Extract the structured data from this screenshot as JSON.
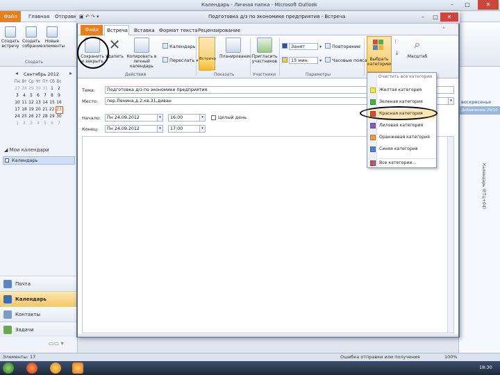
{
  "outlook": {
    "title": "Календарь - Личная папка - Microsoft Outlook",
    "tabs": [
      "Файл",
      "Главная",
      "Отправка и получение"
    ],
    "ribbon_buttons": [
      "Создать встречу",
      "Создать собрание",
      "Новые элементы"
    ],
    "ribbon_group": "Создать",
    "mini_cal": {
      "title": "Сентябрь 2012",
      "weekdays": [
        "Пн",
        "Вт",
        "Ср",
        "Чт",
        "Пт",
        "Сб",
        "Вс"
      ],
      "weeks": [
        [
          "27",
          "28",
          "29",
          "30",
          "31",
          "1",
          "2"
        ],
        [
          "3",
          "4",
          "5",
          "6",
          "7",
          "8",
          "9"
        ],
        [
          "10",
          "11",
          "12",
          "13",
          "14",
          "15",
          "16"
        ],
        [
          "17",
          "18",
          "19",
          "20",
          "21",
          "22",
          "23"
        ],
        [
          "24",
          "25",
          "26",
          "27",
          "28",
          "29",
          "30"
        ],
        [
          "1",
          "2",
          "3",
          "4",
          "5",
          "6",
          "7"
        ]
      ]
    },
    "my_calendars": "Мои календари",
    "calendar_item": "Календарь",
    "nav": {
      "mail": "Почта",
      "calendar": "Календарь",
      "contacts": "Контакты",
      "tasks": "Задачи"
    },
    "right_day": "воскресенье",
    "right_appt": "Добавление 29/10",
    "right_vertical": "Календарь (ЕТЦ+04)",
    "status_left": "Элементы: 17",
    "status_error": "Ошибка отправки или получения",
    "status_zoom": "100%",
    "taskbar_time": "18:30"
  },
  "meeting": {
    "title": "Подготовка д/з по экономике предприятия - Встреча",
    "tabs": {
      "file": "Файл",
      "meeting": "Встреча",
      "insert": "Вставка",
      "format": "Формат текста",
      "review": "Рецензирование"
    },
    "ribbon": {
      "save_close": "Сохранить и закрыть",
      "delete": "Удалить",
      "copy_to": "Копировать в личный календарь",
      "calendar": "Календарь",
      "forward": "Переслать",
      "group_actions": "Действия",
      "meeting_btn": "Встреча",
      "scheduling": "Планирование",
      "group_show": "Показать",
      "invite": "Пригласить участников",
      "group_attendees": "Участники",
      "busy": "Занят",
      "recurrence": "Повторение",
      "reminder": "15 мин.",
      "timezones": "Часовые пояса",
      "group_options": "Параметры",
      "categorize": "Выбрать категорию",
      "zoom": "Масштаб"
    },
    "form": {
      "subject_label": "Тема:",
      "subject_value": "Подготовка д/з по экономике предприятия",
      "location_label": "Место:",
      "location_value": "пер.Ленина,д.2,кв.31,диван",
      "start_label": "Начало:",
      "start_date": "Пн 24.09.2012",
      "start_time": "16:00",
      "end_label": "Конец:",
      "end_date": "Пн 24.09.2012",
      "end_time": "17:00",
      "allday_label": "Целый день"
    }
  },
  "categories": {
    "header": "Очистить все категории",
    "items": [
      {
        "label": "Желтая категория",
        "color": "#f5e642"
      },
      {
        "label": "Зеленая категория",
        "color": "#4cb248"
      },
      {
        "label": "Красная категория",
        "color": "#e0473d"
      },
      {
        "label": "Лиловая категория",
        "color": "#8f5bb8"
      },
      {
        "label": "Оранжевая категория",
        "color": "#f29a3b"
      },
      {
        "label": "Синяя категория",
        "color": "#4f86c9"
      }
    ],
    "all": "Все категории..."
  }
}
